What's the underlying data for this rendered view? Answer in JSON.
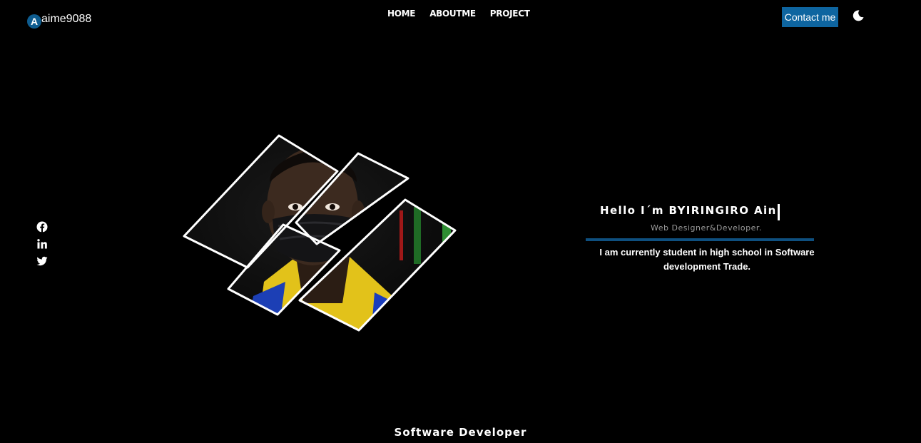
{
  "logo": {
    "badge": "A",
    "text": "aime9088"
  },
  "nav": {
    "items": [
      "HOME",
      "ABOUTME",
      "PROJECT"
    ]
  },
  "header": {
    "contact_label": "Contact me"
  },
  "theme": {
    "icon": "moon-icon"
  },
  "socials": [
    "facebook-icon",
    "linkedin-icon",
    "twitter-icon"
  ],
  "hero": {
    "greeting": "Hello I´m BYIRINGIRO Ain",
    "role": "Web Designer&Developer.",
    "bio": "I am currently student in high school in Software development Trade."
  },
  "footer": {
    "title": "Software Developer"
  },
  "colors": {
    "accent": "#0e65a0",
    "line": "#0e4f7f",
    "background": "#000000"
  }
}
